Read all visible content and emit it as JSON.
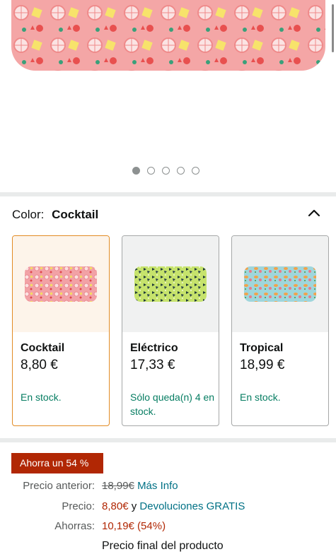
{
  "carousel": {
    "total_images": 5,
    "active_index": 0
  },
  "color_selector": {
    "label": "Color:",
    "selected": "Cocktail",
    "options": [
      {
        "name": "Cocktail",
        "price": "8,80 €",
        "stock": "En stock.",
        "selected": true,
        "pattern": "pink-citrus"
      },
      {
        "name": "Eléctrico",
        "price": "17,33 €",
        "stock": "Sólo queda(n) 4 en stock.",
        "selected": false,
        "pattern": "green-dark-birds"
      },
      {
        "name": "Tropical",
        "price": "18,99 €",
        "stock": "En stock.",
        "selected": false,
        "pattern": "blue-fruits"
      }
    ]
  },
  "pricing": {
    "savings_badge": "Ahorra un 54 %",
    "previous_label": "Precio anterior:",
    "previous_value": "18,99€",
    "more_info": "Más Info",
    "price_label": "Precio:",
    "price_value": "8,80€",
    "price_conj": "y",
    "returns_link": "Devoluciones GRATIS",
    "savings_label": "Ahorras:",
    "savings_value": "10,19€ (54%)",
    "final_note": "Precio final del producto"
  },
  "colors": {
    "stock_green": "#067d62",
    "deal_red": "#b12704",
    "link_teal": "#007185",
    "selected_orange": "#e28b24"
  }
}
